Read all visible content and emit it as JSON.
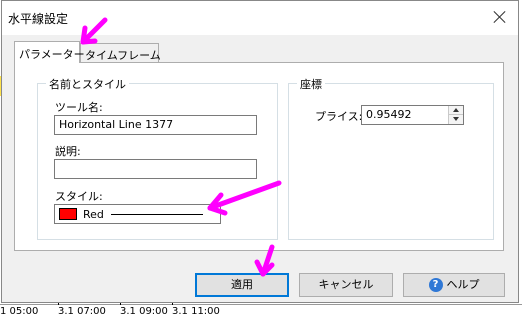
{
  "window": {
    "title": "水平線設定"
  },
  "tabs": [
    {
      "label": "パラメーター",
      "active": true
    },
    {
      "label": "タイムフレーム",
      "active": false
    }
  ],
  "name_style_group": {
    "legend": "名前とスタイル",
    "tool_name_label": "ツール名:",
    "tool_name_value": "Horizontal Line 1377",
    "description_label": "説明:",
    "description_value": "",
    "style_label": "スタイル:",
    "style_color_name": "Red",
    "style_color": "#ff0000"
  },
  "coordinates_group": {
    "legend": "座標",
    "price_label": "プライス:",
    "price_value": "0.95492"
  },
  "buttons": {
    "apply": "適用",
    "cancel": "キャンセル",
    "help": "ヘルプ"
  },
  "background_chart": {
    "time_labels": [
      "1 05:00",
      "3.1 07:00",
      "3.1 09:00",
      "3.1 11:00"
    ]
  },
  "annotation_color": "#ff00ff"
}
